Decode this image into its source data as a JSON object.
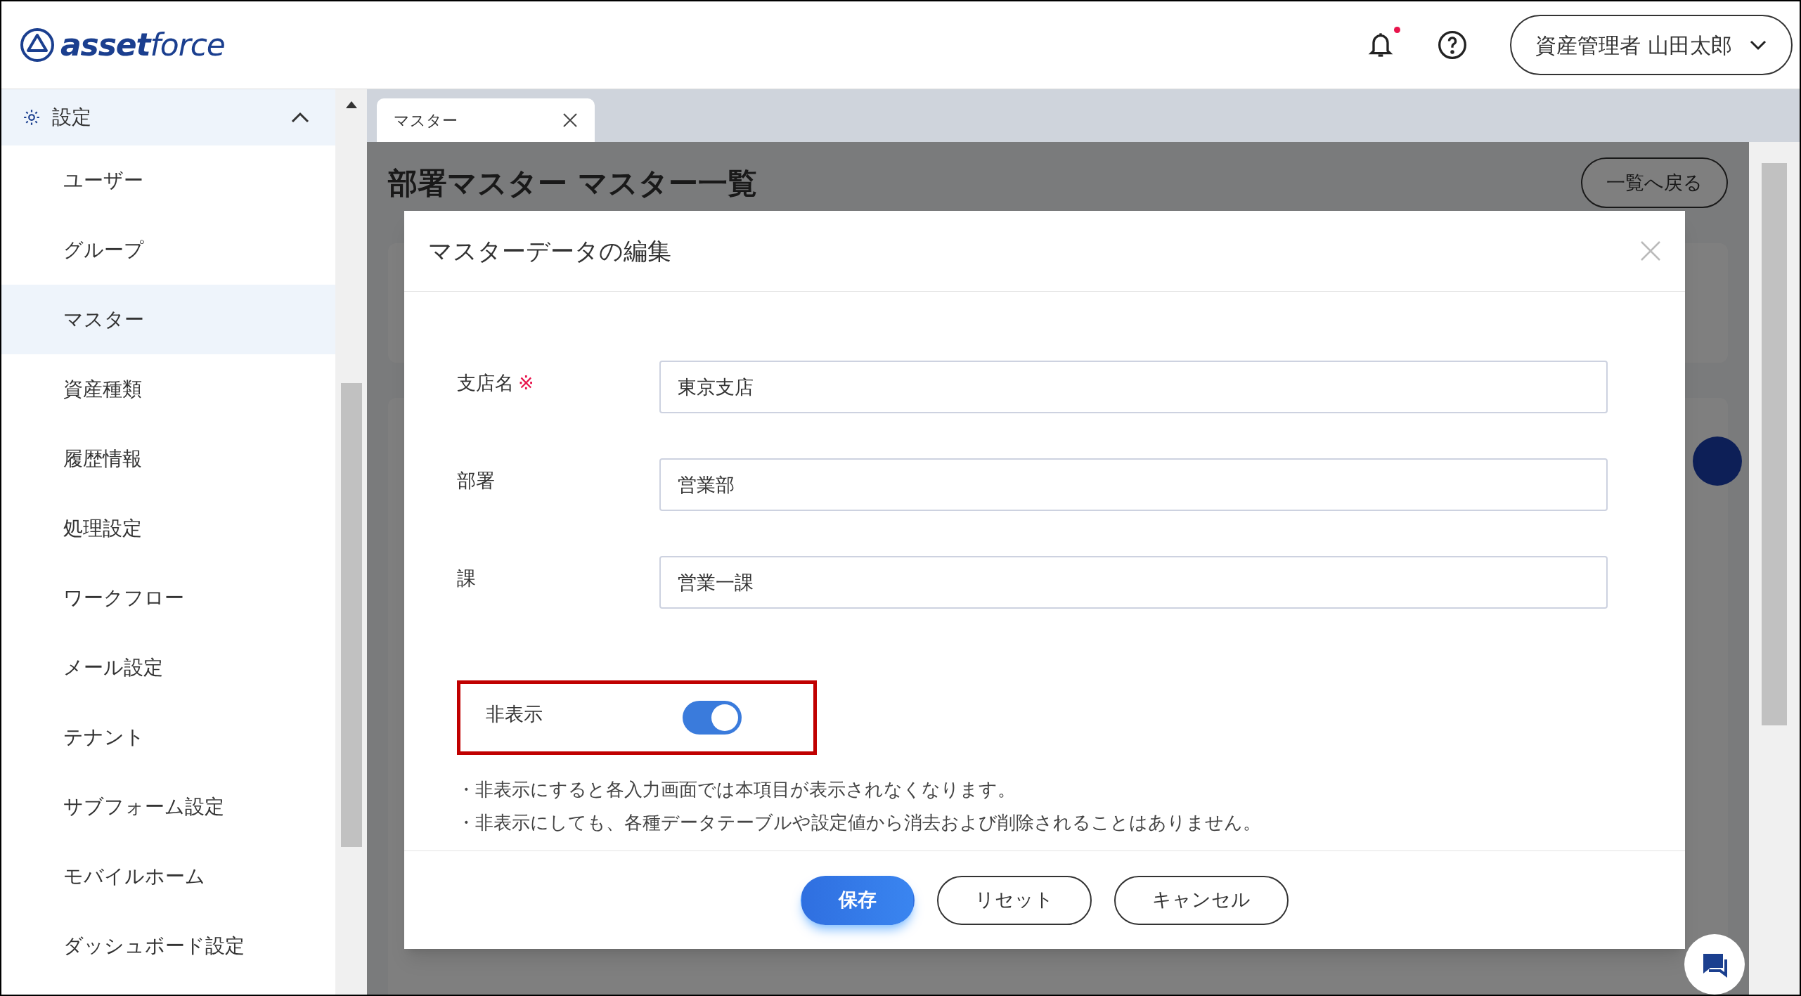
{
  "header": {
    "logo": [
      "asset",
      "force"
    ],
    "notification_unread": true,
    "user_menu": "資産管理者 山田太郎"
  },
  "sidebar": {
    "section": {
      "label": "設定",
      "expanded": true
    },
    "items": [
      {
        "label": "ユーザー",
        "selected": false
      },
      {
        "label": "グループ",
        "selected": false
      },
      {
        "label": "マスター",
        "selected": true
      },
      {
        "label": "資産種類",
        "selected": false
      },
      {
        "label": "履歴情報",
        "selected": false
      },
      {
        "label": "処理設定",
        "selected": false
      },
      {
        "label": "ワークフロー",
        "selected": false
      },
      {
        "label": "メール設定",
        "selected": false
      },
      {
        "label": "テナント",
        "selected": false
      },
      {
        "label": "サブフォーム設定",
        "selected": false
      },
      {
        "label": "モバイルホーム",
        "selected": false
      },
      {
        "label": "ダッシュボード設定",
        "selected": false
      }
    ]
  },
  "tabs": [
    {
      "label": "マスター",
      "selected": true
    }
  ],
  "page": {
    "title": "部署マスター マスター一覧",
    "back_button": "一覧へ戻る"
  },
  "dialog": {
    "title": "マスターデータの編集",
    "fields": [
      {
        "label": "支店名",
        "required_mark": "※",
        "value": "東京支店"
      },
      {
        "label": "部署",
        "value": "営業部"
      },
      {
        "label": "課",
        "value": "営業一課"
      }
    ],
    "hidden_toggle": {
      "label": "非表示",
      "on": true,
      "highlighted": true
    },
    "notes": [
      "・非表示にすると各入力画面では本項目が表示されなくなります。",
      "・非表示にしても、各種データテーブルや設定値から消去および削除されることはありません。"
    ],
    "buttons": [
      {
        "label": "保存",
        "kind": "primary"
      },
      {
        "label": "リセット",
        "kind": "outline"
      },
      {
        "label": "キャンセル",
        "kind": "outline"
      }
    ]
  }
}
